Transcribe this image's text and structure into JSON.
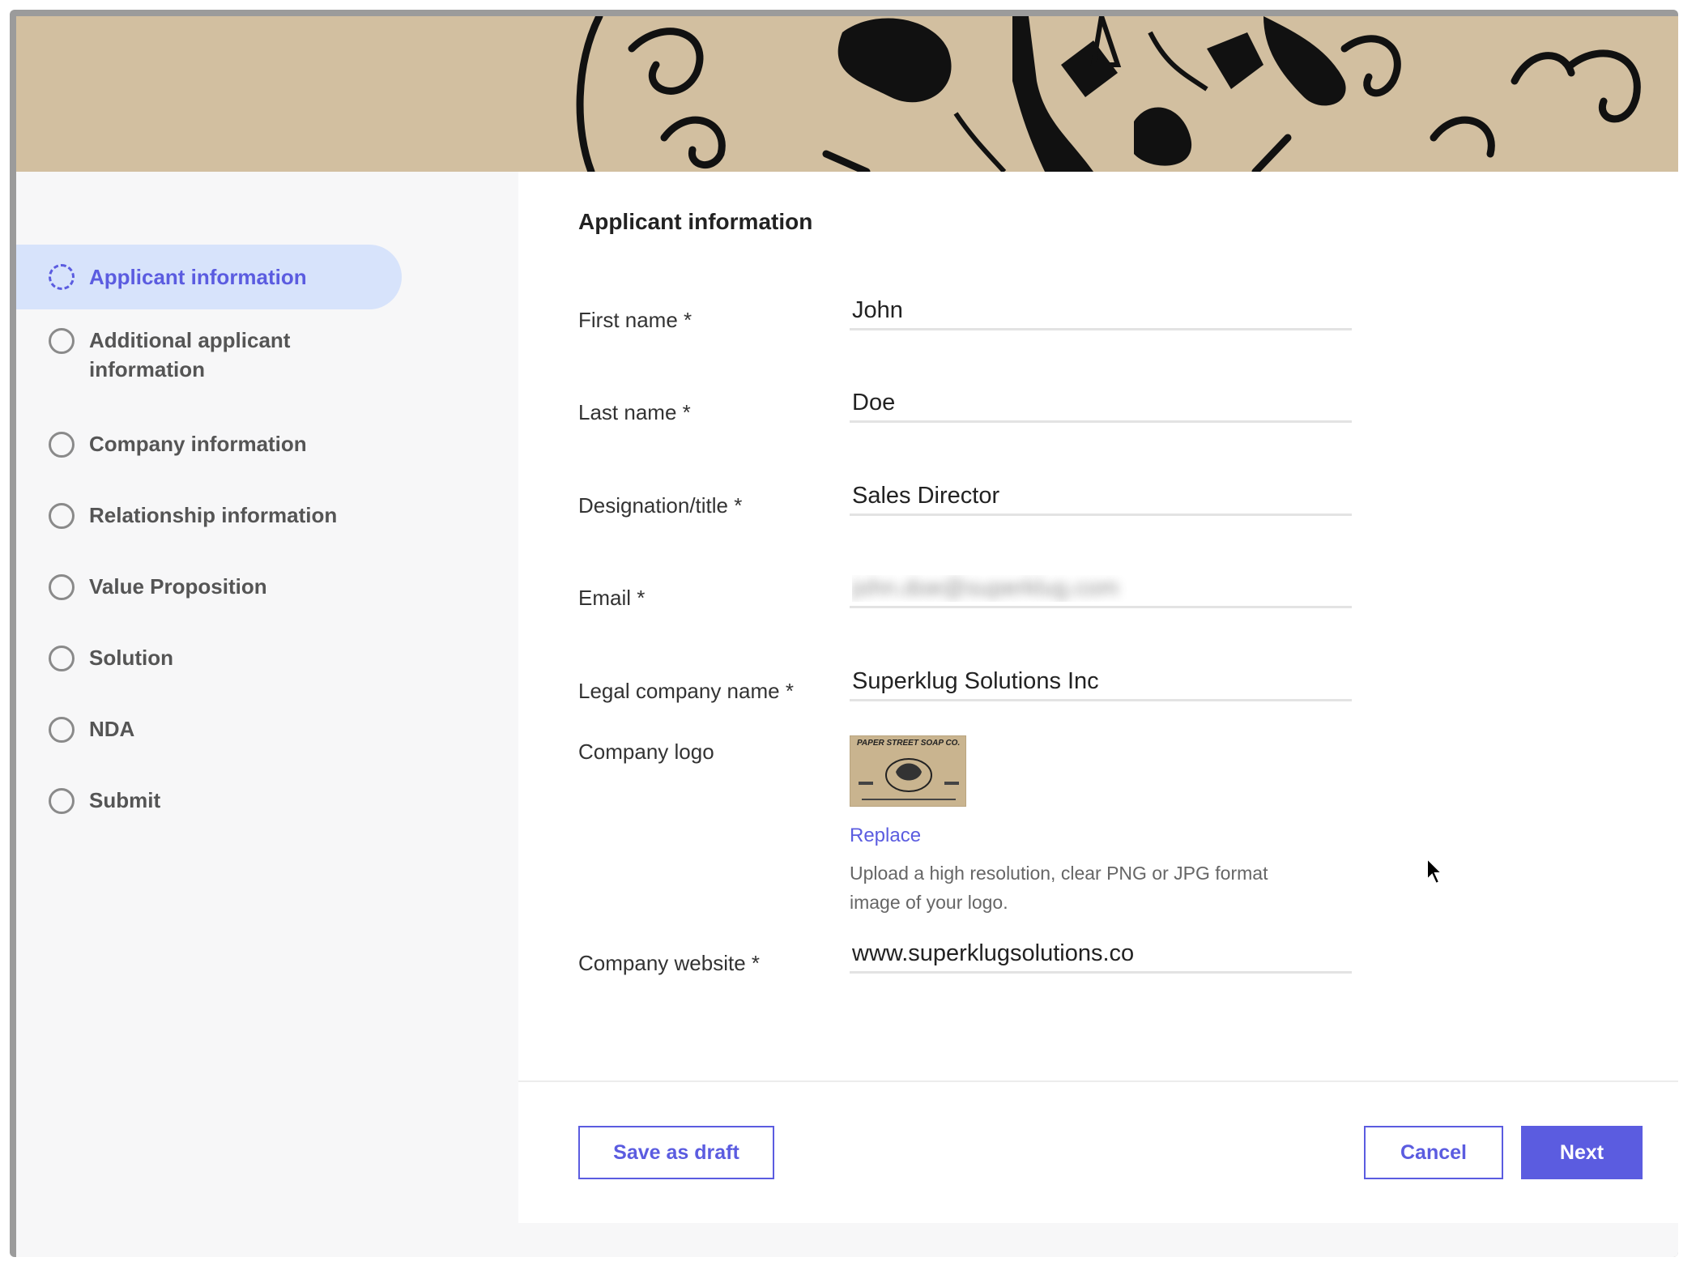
{
  "sidebar": {
    "steps": [
      {
        "label": "Applicant information",
        "active": true
      },
      {
        "label": "Additional applicant information"
      },
      {
        "label": "Company information"
      },
      {
        "label": "Relationship information"
      },
      {
        "label": "Value Proposition"
      },
      {
        "label": "Solution"
      },
      {
        "label": "NDA"
      },
      {
        "label": "Submit"
      }
    ]
  },
  "form": {
    "title": "Applicant information",
    "fields": {
      "first_name": {
        "label": "First name *",
        "value": "John"
      },
      "last_name": {
        "label": "Last name *",
        "value": "Doe"
      },
      "designation": {
        "label": "Designation/title *",
        "value": "Sales Director"
      },
      "email": {
        "label": "Email *",
        "value": "john.doe@superklug.com"
      },
      "legal_company_name": {
        "label": "Legal company name *",
        "value": "Superklug Solutions Inc"
      },
      "company_website": {
        "label": "Company website *",
        "value": "www.superklugsolutions.co"
      }
    },
    "logo": {
      "label": "Company logo",
      "image_text": "PAPER STREET SOAP CO.",
      "replace_label": "Replace",
      "helper": "Upload a high resolution, clear PNG or JPG format image of your logo."
    }
  },
  "footer": {
    "save_draft": "Save as draft",
    "cancel": "Cancel",
    "next": "Next"
  },
  "colors": {
    "accent": "#5b5ce0",
    "active_step_bg": "#d7e3fb",
    "banner_bg": "#d2bfa0"
  }
}
